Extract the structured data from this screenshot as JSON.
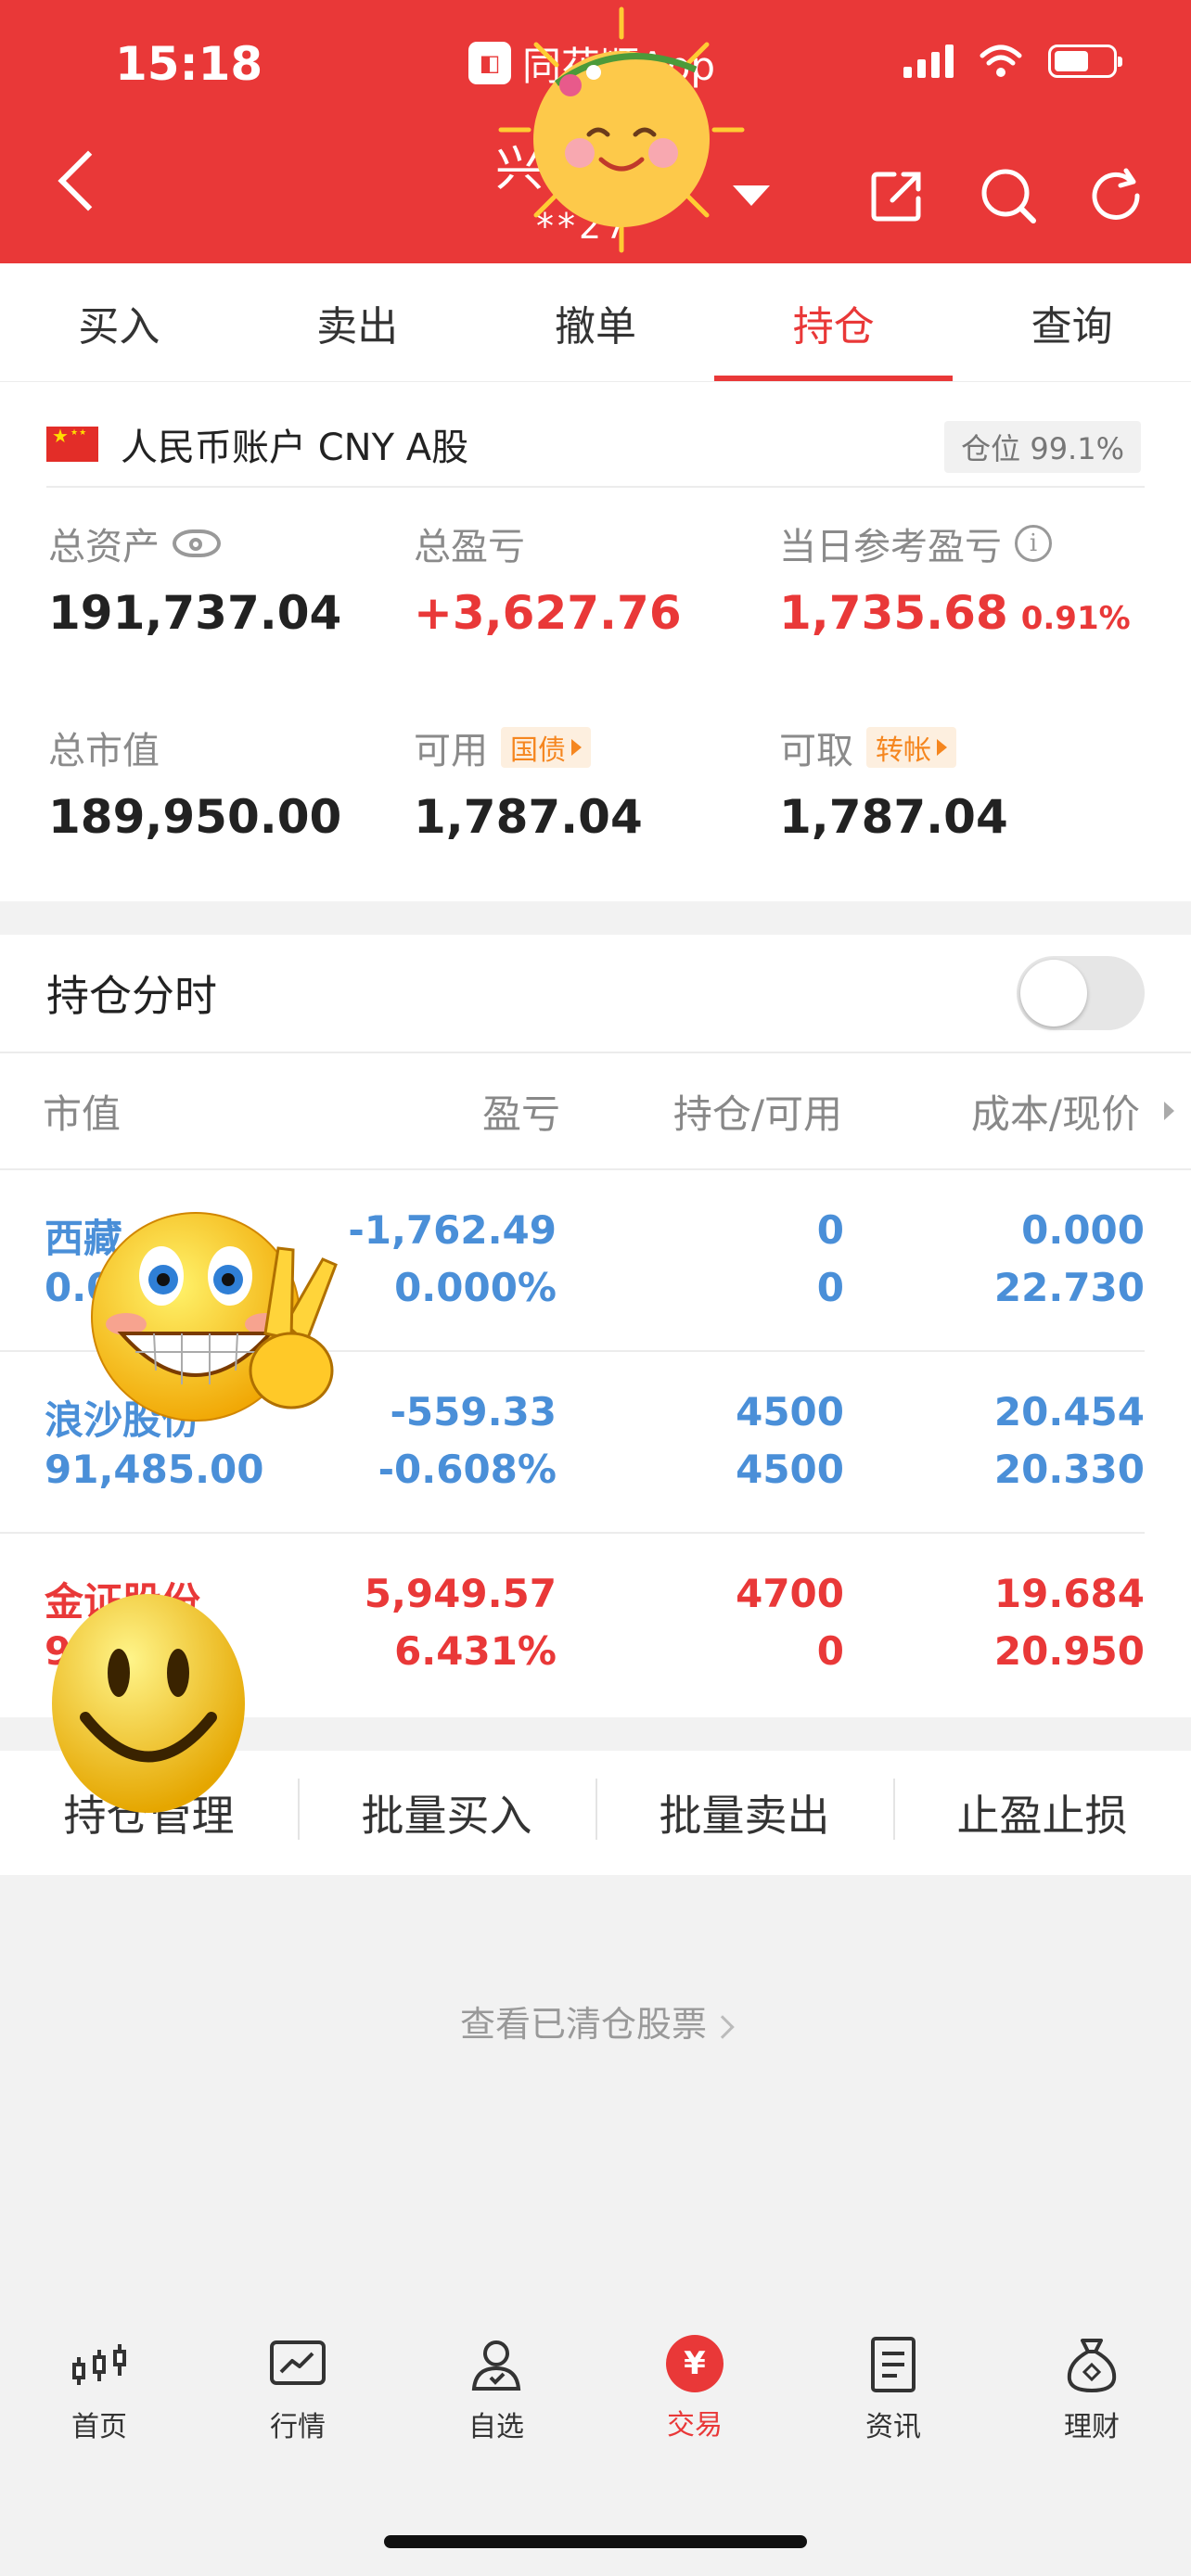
{
  "status_bar": {
    "time": "15:18",
    "app": "同花顺App"
  },
  "header": {
    "account_name": "兴",
    "account_no": "**27"
  },
  "tabs": [
    {
      "label": "买入",
      "active": false
    },
    {
      "label": "卖出",
      "active": false
    },
    {
      "label": "撤单",
      "active": false
    },
    {
      "label": "持仓",
      "active": true
    },
    {
      "label": "查询",
      "active": false
    }
  ],
  "account": {
    "currency_label": "人民币账户 CNY A股",
    "position_ratio": "仓位 99.1%",
    "total_assets_label": "总资产",
    "total_assets": "191,737.04",
    "total_pl_label": "总盈亏",
    "total_pl": "+3,627.76",
    "daily_pl_label": "当日参考盈亏",
    "daily_pl": "1,735.68",
    "daily_pl_pct": "0.91%",
    "market_value_label": "总市值",
    "market_value": "189,950.00",
    "available_label": "可用",
    "available_tag": "国债",
    "available": "1,787.04",
    "withdrawable_label": "可取",
    "withdrawable_tag": "转帐",
    "withdrawable": "1,787.04"
  },
  "holdings": {
    "fenshi_label": "持仓分时",
    "fenshi_on": false,
    "columns": [
      "市值",
      "盈亏",
      "持仓/可用",
      "成本/现价"
    ],
    "rows": [
      {
        "name": "西藏",
        "market_value": "0.0",
        "pl": "-1,762.49",
        "pl_pct": "0.000%",
        "hold": "0",
        "avail": "0",
        "cost": "0.000",
        "price": "22.730",
        "color": "#4a8fd8"
      },
      {
        "name": "浪沙股份",
        "market_value": "91,485.00",
        "pl": "-559.33",
        "pl_pct": "-0.608%",
        "hold": "4500",
        "avail": "4500",
        "cost": "20.454",
        "price": "20.330",
        "color": "#4a8fd8"
      },
      {
        "name": "金证股份",
        "market_value": "9",
        "pl": "5,949.57",
        "pl_pct": "6.431%",
        "hold": "4700",
        "avail": "0",
        "cost": "19.684",
        "price": "20.950",
        "color": "#e93838"
      }
    ]
  },
  "actions": [
    "持仓管理",
    "批量买入",
    "批量卖出",
    "止盈止损"
  ],
  "cleared_link": "查看已清仓股票",
  "bottom_nav": [
    {
      "label": "首页",
      "icon": "candlestick-icon"
    },
    {
      "label": "行情",
      "icon": "chart-icon"
    },
    {
      "label": "自选",
      "icon": "user-icon"
    },
    {
      "label": "交易",
      "icon": "yuan-icon",
      "active": true
    },
    {
      "label": "资讯",
      "icon": "document-icon"
    },
    {
      "label": "理财",
      "icon": "money-bag-icon"
    }
  ],
  "colors": {
    "brand_red": "#e93838",
    "loss_blue": "#4a8fd8",
    "tag_orange": "#f5861f"
  }
}
